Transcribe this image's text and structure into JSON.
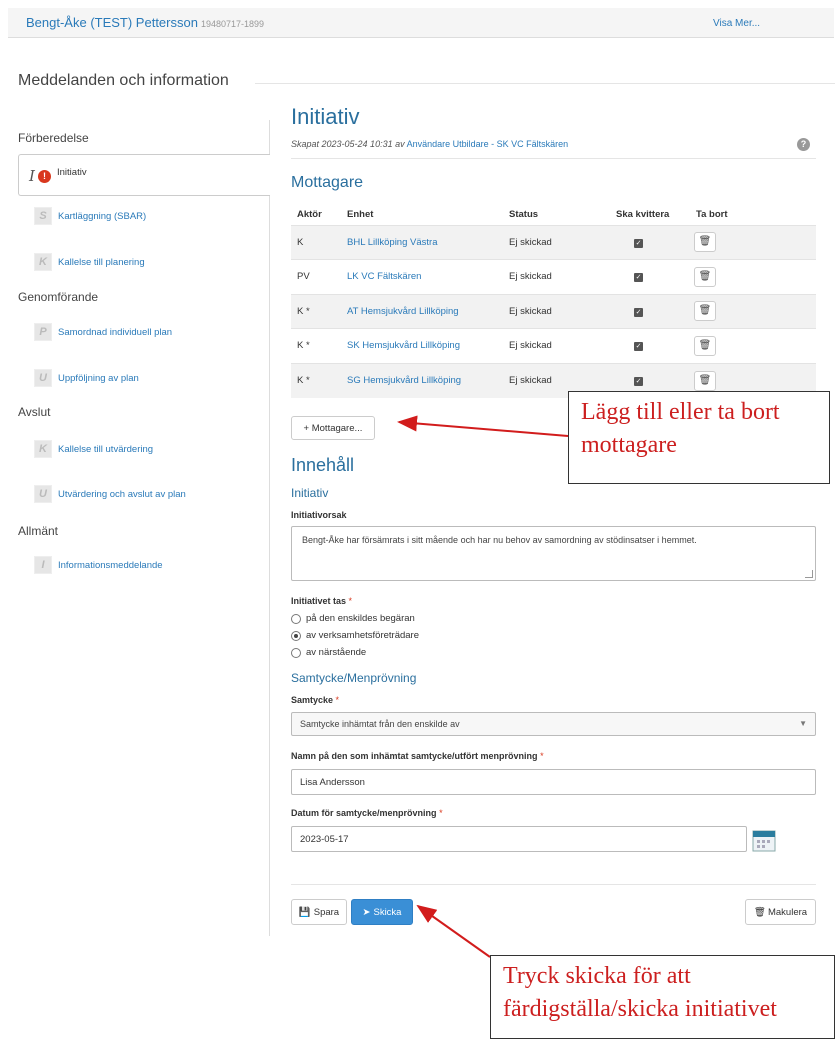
{
  "header": {
    "patient_name": "Bengt-Åke (TEST) Pettersson",
    "personnummer": "19480717-1899",
    "visa_mer": "Visa Mer..."
  },
  "section_heading": "Meddelanden och information",
  "sidebar": {
    "groups": [
      {
        "label": "Förberedelse"
      },
      {
        "label": "Genomförande"
      },
      {
        "label": "Avslut"
      },
      {
        "label": "Allmänt"
      }
    ],
    "items": [
      {
        "label": "Initiativ",
        "icon": "I",
        "active": true
      },
      {
        "label": "Kartläggning (SBAR)",
        "icon": "S"
      },
      {
        "label": "Kallelse till planering",
        "icon": "K"
      },
      {
        "label": "Samordnad individuell plan",
        "icon": "P"
      },
      {
        "label": "Uppföljning av plan",
        "icon": "U"
      },
      {
        "label": "Kallelse till utvärdering",
        "icon": "K"
      },
      {
        "label": "Utvärdering och avslut av plan",
        "icon": "U"
      },
      {
        "label": "Informationsmeddelande",
        "icon": "I"
      }
    ]
  },
  "main": {
    "title": "Initiativ",
    "created_prefix": "Skapat 2023-05-24 10:31 av",
    "created_by": "Användare Utbildare - SK VC Fältskären",
    "recipients_heading": "Mottagare",
    "columns": [
      "Aktör",
      "Enhet",
      "Status",
      "Ska kvittera",
      "Ta bort"
    ],
    "rows": [
      {
        "aktor": "K",
        "enhet": "BHL Lillköping Västra",
        "status": "Ej skickad"
      },
      {
        "aktor": "PV",
        "enhet": "LK VC Fältskären",
        "status": "Ej skickad"
      },
      {
        "aktor": "K *",
        "enhet": "AT Hemsjukvård Lillköping",
        "status": "Ej skickad"
      },
      {
        "aktor": "K *",
        "enhet": "SK Hemsjukvård Lillköping",
        "status": "Ej skickad"
      },
      {
        "aktor": "K *",
        "enhet": "SG Hemsjukvård Lillköping",
        "status": "Ej skickad"
      }
    ],
    "add_recipient": "+ Mottagare...",
    "content_heading": "Innehåll",
    "initiative_sub": "Initiativ",
    "reason_label": "Initiativorsak",
    "reason_text": "Bengt-Åke har försämrats i sitt mående och har nu behov av samordning av stödinsatser i hemmet.",
    "taken_label": "Initiativet tas",
    "required_mark": "*",
    "taken_options": [
      {
        "label": "på den enskildes begäran",
        "selected": false
      },
      {
        "label": "av verksamhetsföreträdare",
        "selected": true
      },
      {
        "label": "av närstående",
        "selected": false
      }
    ],
    "consent_sub": "Samtycke/Menprövning",
    "consent_label": "Samtycke",
    "consent_value": "Samtycke inhämtat från den enskilde av",
    "name_label": "Namn på den som inhämtat samtycke/utfört menprövning",
    "name_value": "Lisa Andersson",
    "date_label": "Datum för samtycke/menprövning",
    "date_value": "2023-05-17",
    "save_label": "Spara",
    "send_label": "Skicka",
    "cancel_label": "Makulera"
  },
  "annotations": {
    "callout_1": [
      "Lägg till eller ta bort",
      "mottagare"
    ],
    "callout_2": [
      "Tryck skicka för att",
      "färdigställa/skicka initiativet"
    ],
    "color": "#cc1f1f"
  }
}
